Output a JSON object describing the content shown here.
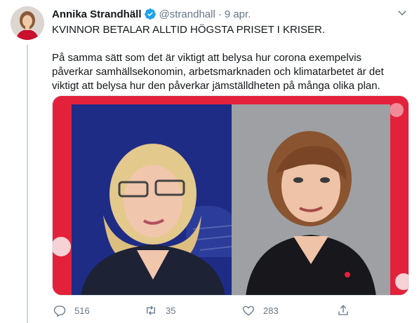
{
  "tweet": {
    "author_name": "Annika Strandhäll",
    "handle": "@strandhall",
    "separator": "·",
    "time": "9 apr.",
    "text_line1": "KVINNOR BETALAR ALLTID HÖGSTA PRISET I KRISER.",
    "text_line2": "På samma sätt som det är viktigt att belysa hur corona exempelvis påverkar samhällsekonomin, arbetsmarknaden och klimatarbetet är det viktigt att belysa hur den påverkar jämställdheten på många olika plan."
  },
  "actions": {
    "reply_count": "516",
    "retweet_count": "35",
    "like_count": "283"
  },
  "icons": {
    "verified": "verified-badge-icon",
    "caret": "chevron-down-icon",
    "reply": "reply-icon",
    "retweet": "retweet-icon",
    "like": "heart-icon",
    "share": "share-icon"
  },
  "colors": {
    "accent": "#1da1f2",
    "muted": "#657786",
    "text": "#14171a",
    "media_red": "#e3213b",
    "media_blue": "#1e2c86"
  }
}
